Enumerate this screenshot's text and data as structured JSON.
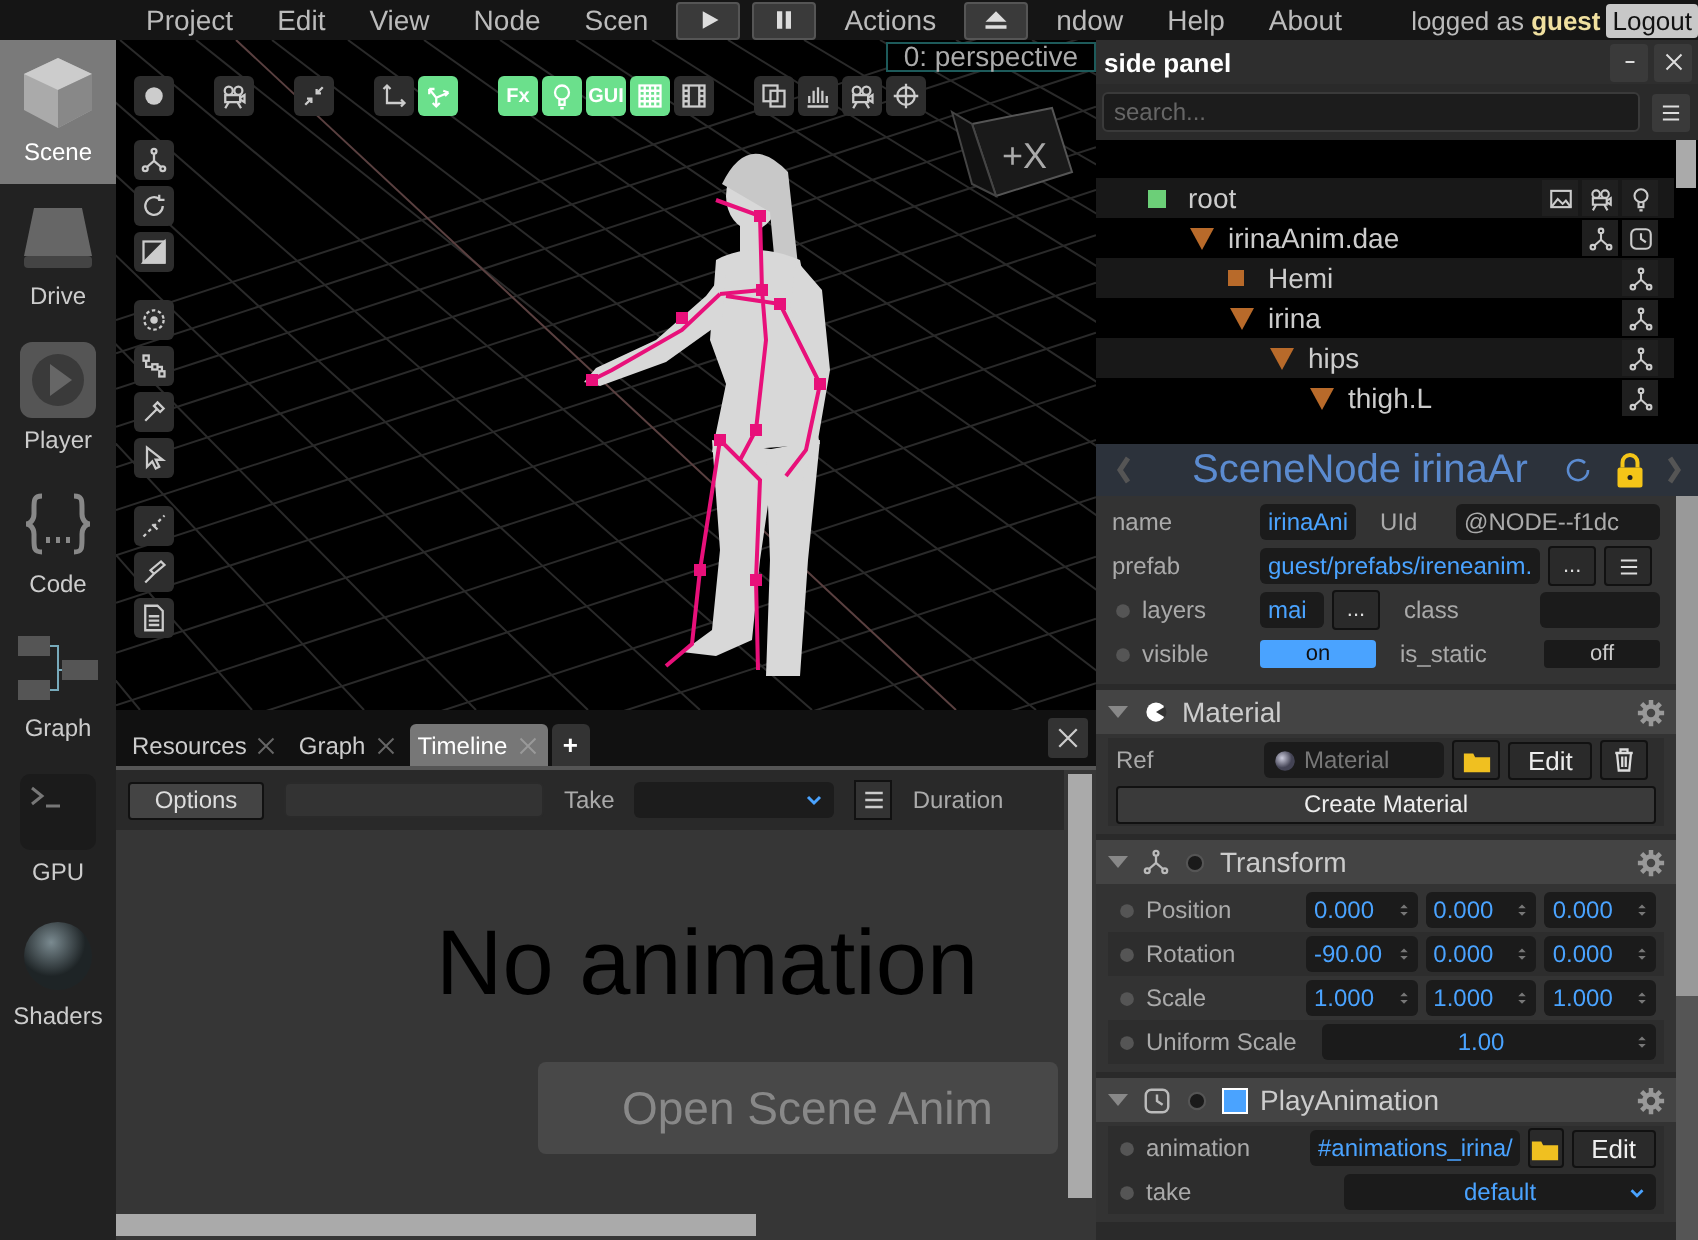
{
  "menubar": {
    "items": [
      {
        "kind": "menu",
        "label": "Project"
      },
      {
        "kind": "menu",
        "label": "Edit"
      },
      {
        "kind": "menu",
        "label": "View"
      },
      {
        "kind": "menu",
        "label": "Node"
      },
      {
        "kind": "menu",
        "label": "Scen"
      },
      {
        "kind": "play"
      },
      {
        "kind": "pause"
      },
      {
        "kind": "menu",
        "label": "Actions"
      },
      {
        "kind": "eject"
      },
      {
        "kind": "menu",
        "label": "ndow"
      },
      {
        "kind": "menu",
        "label": "Help"
      },
      {
        "kind": "menu",
        "label": "About"
      }
    ],
    "user_text": "logged as **guest**",
    "logout": "Logout"
  },
  "sidebar": {
    "items": [
      {
        "kind": "cube",
        "label": "Scene",
        "selected": true
      },
      {
        "kind": "drive",
        "label": "Drive",
        "selected": false
      },
      {
        "kind": "player",
        "label": "Player",
        "selected": false
      },
      {
        "kind": "code",
        "label": "Code",
        "selected": false
      },
      {
        "kind": "graph",
        "label": "Graph",
        "selected": false
      },
      {
        "kind": "terminal",
        "label": "GPU",
        "selected": false
      },
      {
        "kind": "sphere",
        "label": "Shaders",
        "selected": false
      }
    ]
  },
  "viewport": {
    "camera_label": "0: perspective",
    "gizmo_label": "+X",
    "top_tools": [
      [
        {
          "kind": "dot",
          "on": false
        }
      ],
      [
        {
          "kind": "camera",
          "on": false
        }
      ],
      [
        {
          "kind": "collapse",
          "on": false
        }
      ],
      [
        {
          "kind": "axes",
          "on": false
        },
        {
          "kind": "move",
          "on": true
        }
      ],
      [
        {
          "kind": "text",
          "label": "Fx",
          "on": true
        },
        {
          "kind": "bulb",
          "on": true
        },
        {
          "kind": "text",
          "label": "GUI",
          "on": true
        },
        {
          "kind": "grid",
          "on": true
        },
        {
          "kind": "film",
          "on": false
        }
      ],
      [
        {
          "kind": "copy",
          "on": false
        },
        {
          "kind": "particles",
          "on": false
        },
        {
          "kind": "camera",
          "on": false
        },
        {
          "kind": "crosshair",
          "on": false
        }
      ]
    ],
    "left_tools": [
      [
        {
          "kind": "tree"
        },
        {
          "kind": "rotate"
        },
        {
          "kind": "scale"
        }
      ],
      [
        {
          "kind": "target"
        },
        {
          "kind": "joints"
        },
        {
          "kind": "pipette"
        },
        {
          "kind": "cursor"
        }
      ],
      [
        {
          "kind": "line"
        },
        {
          "kind": "brush"
        },
        {
          "kind": "doc"
        }
      ]
    ]
  },
  "bottom_panel": {
    "tabs": [
      {
        "label": "Resources",
        "selected": false
      },
      {
        "label": "Graph",
        "selected": false
      },
      {
        "label": "Timeline",
        "selected": true
      }
    ],
    "add_label": "+",
    "options": "Options",
    "take_label": "Take",
    "duration_label": "Duration",
    "message": "No animation",
    "open_button": "Open Scene Anim"
  },
  "side_panel": {
    "title": "side panel",
    "search": {
      "placeholder": "search..."
    },
    "tree": [
      {
        "label": "root",
        "kind": "root",
        "children": [
          {
            "label": "irinaAnim.dae",
            "kind": "scene",
            "expanded": true,
            "children": [
              {
                "label": "Hemi",
                "kind": "leaf"
              },
              {
                "label": "irina",
                "kind": "node",
                "expanded": true,
                "children": [
                  {
                    "label": "hips",
                    "kind": "node",
                    "expanded": true,
                    "children": [
                      {
                        "label": "thigh.L",
                        "kind": "node",
                        "expanded": true
                      }
                    ]
                  }
                ]
              }
            ]
          }
        ]
      }
    ],
    "inspector": {
      "title": "SceneNode irinaAr",
      "name_label": "name",
      "name_value": "irinaAni",
      "uid_label": "UId",
      "uid_value": "@NODE--f1dc",
      "prefab_label": "prefab",
      "prefab_value": "guest/prefabs/ireneanim.",
      "prefab_button": "...",
      "layers_label": "layers",
      "layers_value": "mai",
      "layers_button": "...",
      "class_label": "class",
      "visible_label": "visible",
      "visible": {
        "text": "on",
        "on": true
      },
      "is_static_label": "is_static",
      "is_static": {
        "text": "off",
        "on": false
      },
      "components": [
        {
          "kind": "material",
          "title": "Material",
          "ref_label": "Ref",
          "ref_placeholder": "Material",
          "edit": "Edit",
          "create": "Create Material"
        },
        {
          "kind": "transform",
          "title": "Transform",
          "rows": [
            {
              "label": "Position",
              "values": [
                "0.000",
                "0.000",
                "0.000"
              ]
            },
            {
              "label": "Rotation",
              "values": [
                "-90.00",
                "0.000",
                "0.000"
              ]
            },
            {
              "label": "Scale",
              "values": [
                "1.000",
                "1.000",
                "1.000"
              ]
            }
          ],
          "uniform_label": "Uniform Scale",
          "uniform_value": "1.00"
        },
        {
          "kind": "animation",
          "title": "PlayAnimation",
          "enabled": true,
          "animation_label": "animation",
          "animation_value": "#animations_irina/",
          "edit": "Edit",
          "take_label": "take",
          "take_value": "default"
        }
      ]
    }
  }
}
